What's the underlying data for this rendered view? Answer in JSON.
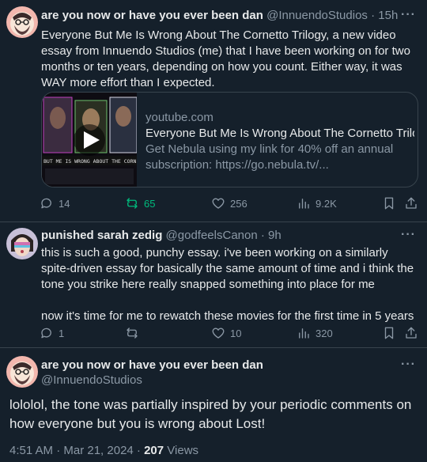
{
  "tweet1": {
    "display_name": "are you now or have you ever been dan",
    "handle": "@InnuendoStudios",
    "time": "15h",
    "text": "Everyone But Me Is Wrong About The Cornetto Trilogy, a new video essay from Innuendo Studios (me) that I have been working on for two months or ten years, depending on how you count. Either way, it was WAY more effort than I expected.",
    "card": {
      "domain": "youtube.com",
      "title": "Everyone But Me Is Wrong About The Cornetto Trilogy",
      "description": "Get Nebula using my link for 40% off an annual subscription: https://go.nebula.tv/...",
      "thumb_caption": "BUT ME IS WRONG ABOUT THE CORNET"
    },
    "replies": "14",
    "reposts": "65",
    "likes": "256",
    "views": "9.2K"
  },
  "tweet2": {
    "display_name": "punished sarah zedig",
    "handle": "@godfeelsCanon",
    "time": "9h",
    "text": "this is such a good, punchy essay. i've been working on a similarly spite-driven essay for basically the same amount of time and i think the tone you strike here really snapped something into place for me\n\nnow it's time for me to rewatch these movies for the first time in 5 years",
    "replies": "1",
    "reposts": "",
    "likes": "10",
    "views": "320"
  },
  "tweet3": {
    "display_name": "are you now or have you ever been dan",
    "handle": "@InnuendoStudios",
    "text": "lololol, the tone was partially inspired by your periodic comments on how everyone but you is wrong about Lost!",
    "timestamp": "4:51 AM · Mar 21, 2024 · ",
    "views_count": "207",
    "views_label": " Views"
  },
  "ui": {
    "more_glyph": "···",
    "dot": " · ",
    "repost_color": "#00ba7c",
    "muted_color": "#8b98a5"
  }
}
